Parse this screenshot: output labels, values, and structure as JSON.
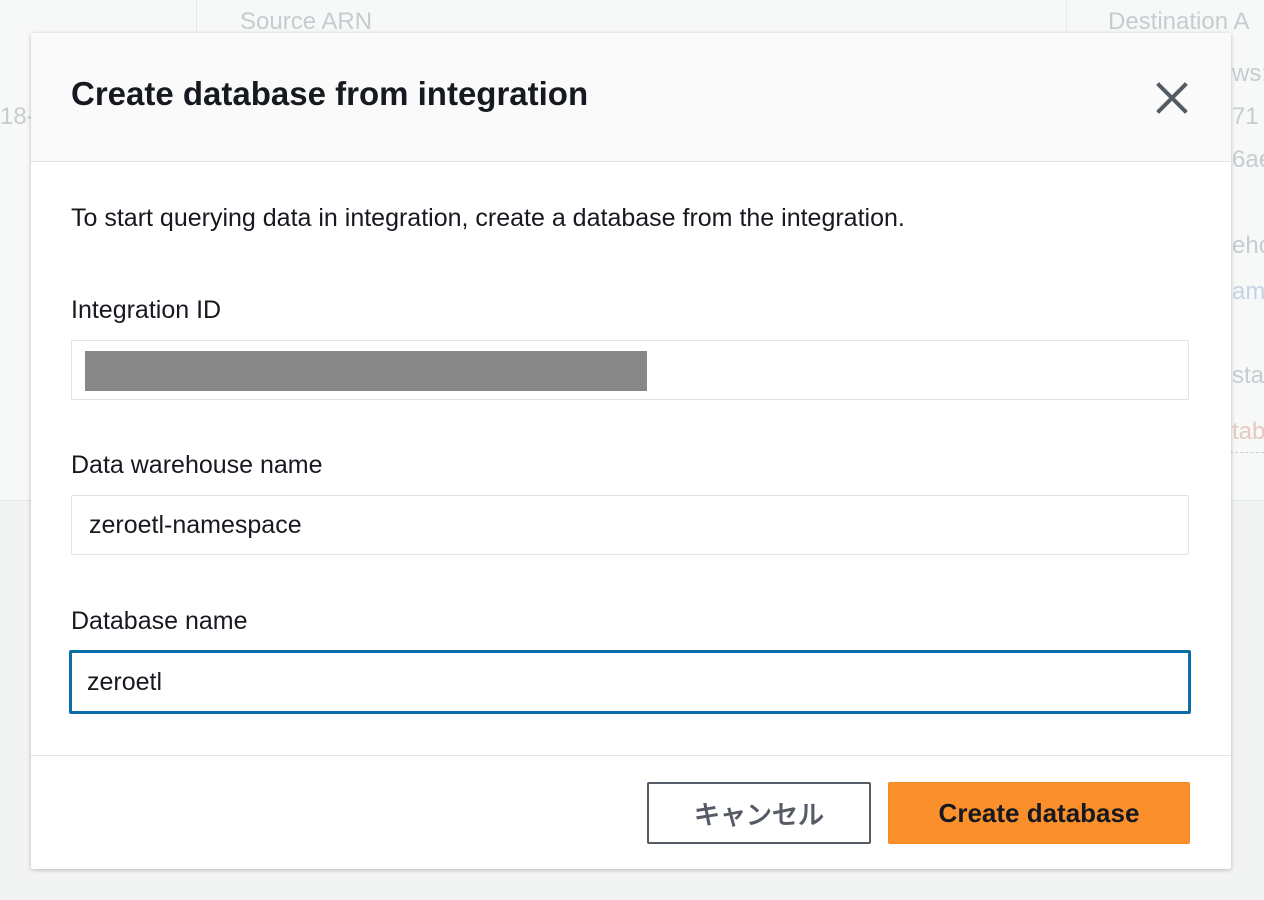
{
  "background": {
    "col_headers": [
      "Source ARN",
      "Destination A"
    ],
    "fragments": [
      "18-",
      "ws:",
      "71",
      "6ae",
      "eho",
      "ame",
      "sta",
      "tab"
    ]
  },
  "modal": {
    "title": "Create database from integration",
    "description": "To start querying data in integration, create a database from the integration.",
    "fields": [
      {
        "label": "Integration ID",
        "value": ""
      },
      {
        "label": "Data warehouse name",
        "value": "zeroetl-namespace"
      },
      {
        "label": "Database name",
        "value": "zeroetl"
      }
    ],
    "buttons": {
      "cancel": "キャンセル",
      "primary": "Create database"
    }
  },
  "colors": {
    "primary_button": "#fb8f2c",
    "focus_border": "#0b6ea8",
    "text": "#16191f",
    "redacted": "#878787"
  },
  "icons": {
    "close": "close-icon"
  }
}
